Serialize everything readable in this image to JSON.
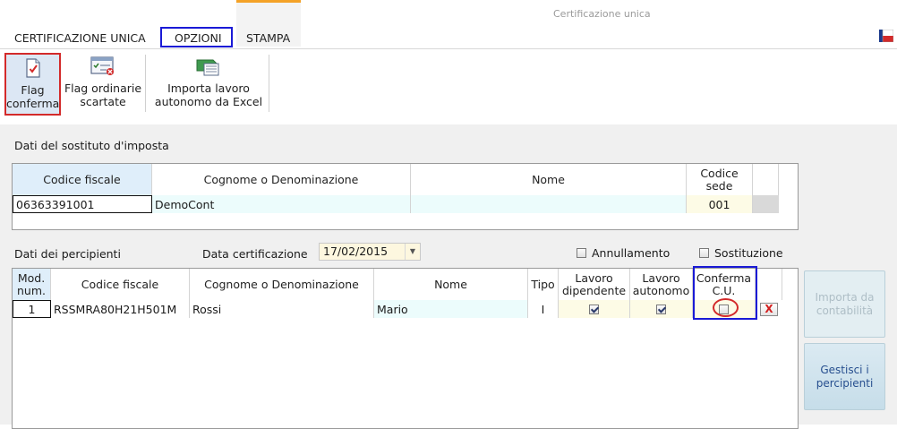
{
  "window": {
    "title": "Certificazione unica"
  },
  "tabs": [
    {
      "label": "CERTIFICAZIONE UNICA"
    },
    {
      "label": "OPZIONI"
    },
    {
      "label": "STAMPA"
    }
  ],
  "ribbon": {
    "flag_conferma": {
      "line1": "Flag",
      "line2": "conferma",
      "icon": "document-check-icon"
    },
    "flag_ordinarie": {
      "line1": "Flag ordinarie",
      "line2": "scartate",
      "icon": "checklist-icon"
    },
    "importa_excel": {
      "line1": "Importa lavoro",
      "line2": "autonomo da Excel",
      "icon": "excel-import-icon"
    }
  },
  "sostituto": {
    "section_label": "Dati del sostituto d'imposta",
    "headers": {
      "cf": "Codice fiscale",
      "cognome": "Cognome o Denominazione",
      "nome": "Nome",
      "sede1": "Codice",
      "sede2": "sede"
    },
    "row": {
      "cf": "06363391001",
      "cognome": "DemoCont",
      "nome": "",
      "sede": "001"
    }
  },
  "percipienti": {
    "section_label": "Dati dei percipienti",
    "data_label": "Data certificazione",
    "data_value": "17/02/2015",
    "annullamento_label": "Annullamento",
    "sostituzione_label": "Sostituzione",
    "headers": {
      "mod1": "Mod.",
      "mod2": "num.",
      "cf": "Codice fiscale",
      "cognome": "Cognome o Denominazione",
      "nome": "Nome",
      "tipo": "Tipo",
      "dip1": "Lavoro",
      "dip2": "dipendente",
      "aut1": "Lavoro",
      "aut2": "autonomo",
      "conf1": "Conferma",
      "conf2": "C.U."
    },
    "rows": [
      {
        "mod": "1",
        "cf": "RSSMRA80H21H501M",
        "cognome": "Rossi",
        "nome": "Mario",
        "tipo": "I",
        "dipendente": true,
        "autonomo": true,
        "conferma": false,
        "delete": "X"
      }
    ]
  },
  "side_buttons": {
    "importa": {
      "line1": "Importa da",
      "line2": "contabilità"
    },
    "gestisci": {
      "line1": "Gestisci i",
      "line2": "percipienti"
    }
  },
  "colors": {
    "accent_tab": "#f4a227",
    "highlight_red": "#d32a2a",
    "highlight_blue": "#1a1ad6"
  }
}
